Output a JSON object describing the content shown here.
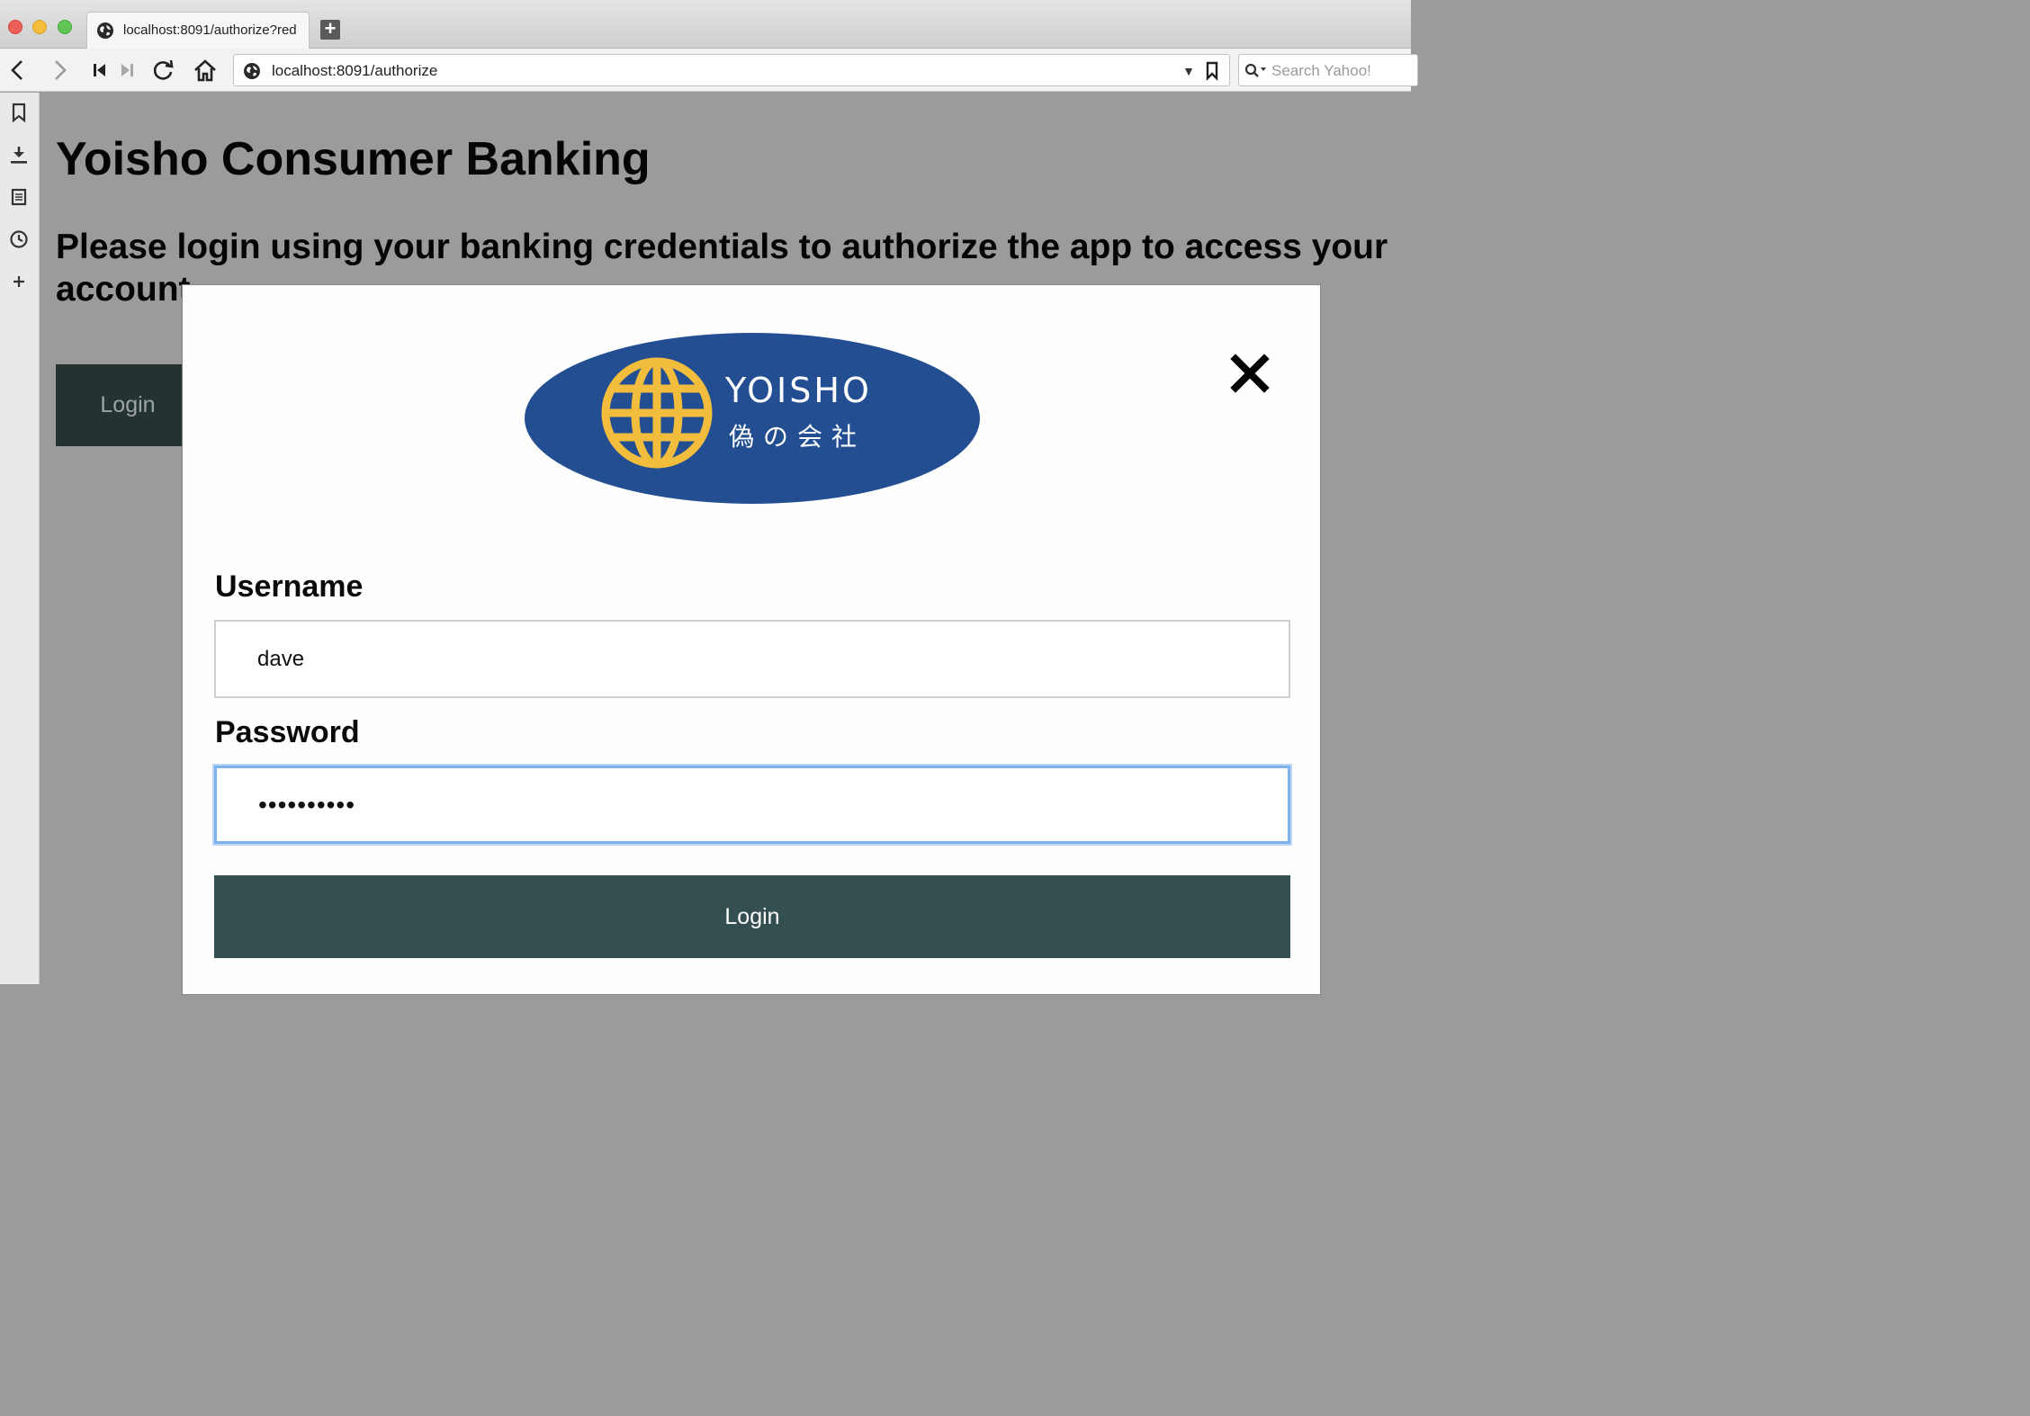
{
  "browser": {
    "tab_title": "localhost:8091/authorize?red",
    "url": "localhost:8091/authorize",
    "search_placeholder": "Search Yahoo!"
  },
  "page": {
    "title": "Yoisho Consumer Banking",
    "subtitle": "Please login using your banking credentials to authorize the app to access your account",
    "background_login_label": "Login"
  },
  "modal": {
    "logo": {
      "name": "YOISHO",
      "tagline": "偽の会社"
    },
    "username_label": "Username",
    "username_value": "dave",
    "password_label": "Password",
    "password_value": "••••••••••",
    "login_label": "Login"
  },
  "colors": {
    "overlay": "#9b9b9b",
    "primary_button": "#344f4f",
    "background_button": "#243231",
    "logo_blue": "#234f92",
    "logo_gold": "#f2bd3c",
    "focus_ring": "#7fb1ec"
  }
}
